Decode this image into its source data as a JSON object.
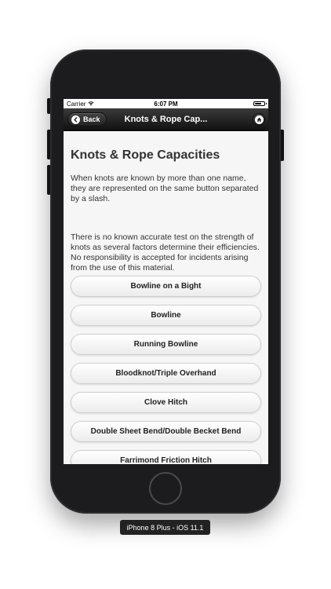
{
  "statusbar": {
    "carrier": "Carrier",
    "time": "6:07 PM",
    "battery_level": 0.75
  },
  "navbar": {
    "back_label": "Back",
    "title": "Knots & Rope Cap..."
  },
  "content": {
    "title": "Knots & Rope Capacities",
    "paragraph_1": "When knots are known by more than one name, they are represented on the same button separated by a slash.",
    "paragraph_2": "There is no known accurate test on the strength of knots as several factors determine their efficiencies.  No responsibility is accepted for incidents arising from the use of this material.",
    "knots": [
      "Bowline on a Bight",
      "Bowline",
      "Running Bowline",
      "Bloodknot/Triple Overhand",
      "Clove Hitch",
      "Double Sheet Bend/Double Becket Bend",
      "Farrimond Friction Hitch"
    ]
  },
  "simulator": {
    "device_label": "iPhone 8 Plus - iOS 11.1"
  },
  "icons": {
    "back": "chevron-left-icon",
    "home": "home-icon",
    "wifi": "wifi-icon",
    "battery": "battery-icon"
  },
  "colors": {
    "navbar": "#1a1a1a",
    "content_bg": "#f6f6f6",
    "button_bg": "#f2f2f2",
    "phone_body": "#1c1c1e"
  }
}
